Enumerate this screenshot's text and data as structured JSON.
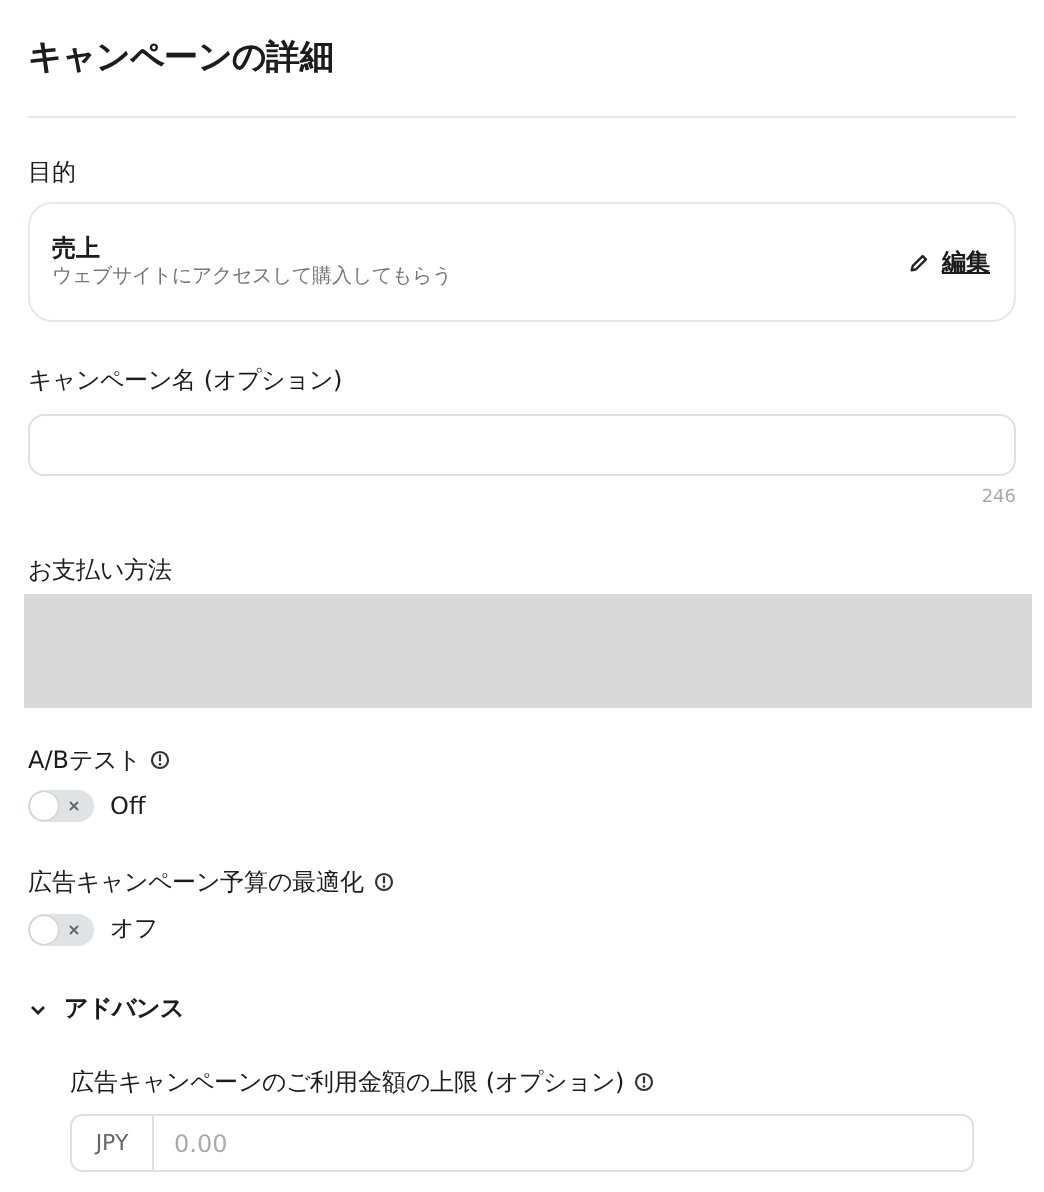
{
  "title": "キャンペーンの詳細",
  "objective": {
    "label": "目的",
    "value": "売上",
    "description": "ウェブサイトにアクセスして購入してもらう",
    "edit": "編集"
  },
  "campaign_name": {
    "label": "キャンペーン名 (オプション)",
    "counter": "246"
  },
  "payment": {
    "label": "お支払い方法"
  },
  "toggles": [
    {
      "label": "A/Bテスト",
      "on": false,
      "state_text": "Off"
    },
    {
      "label": "広告キャンペーン予算の最適化",
      "on": false,
      "state_text": "オフ"
    }
  ],
  "advanced": {
    "label": "アドバンス",
    "expanded": true,
    "spend_limit": {
      "label": "広告キャンペーンのご利用金額の上限 (オプション)",
      "currency": "JPY",
      "placeholder": "0.00"
    }
  }
}
